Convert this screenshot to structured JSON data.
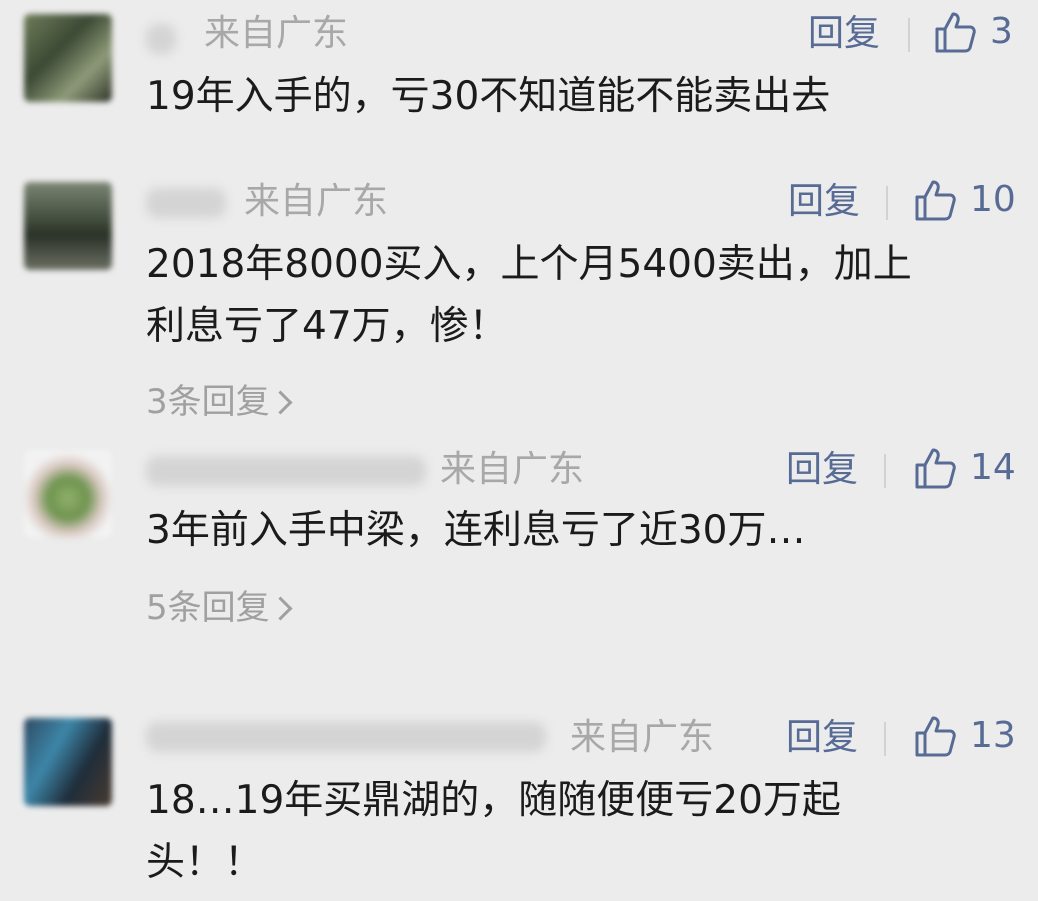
{
  "comments": [
    {
      "location": "来自广东",
      "reply_label": "回复",
      "likes": "3",
      "content": "19年入手的，亏30不知道能不能卖出去"
    },
    {
      "location": "来自广东",
      "reply_label": "回复",
      "likes": "10",
      "content": "2018年8000买入，上个月5400卖出，加上\n利息亏了47万，惨！",
      "replies_label": "3条回复"
    },
    {
      "location": "来自广东",
      "reply_label": "回复",
      "likes": "14",
      "content": "3年前入手中梁，连利息亏了近30万…",
      "replies_label": "5条回复"
    },
    {
      "location": "来自广东",
      "reply_label": "回复",
      "likes": "13",
      "content": "18…19年买鼎湖的，随随便便亏20万起\n头！！"
    }
  ],
  "colors": {
    "background": "#ececec",
    "link": "#576b95",
    "meta": "#a8a8a8",
    "text": "#1b1b1b"
  }
}
